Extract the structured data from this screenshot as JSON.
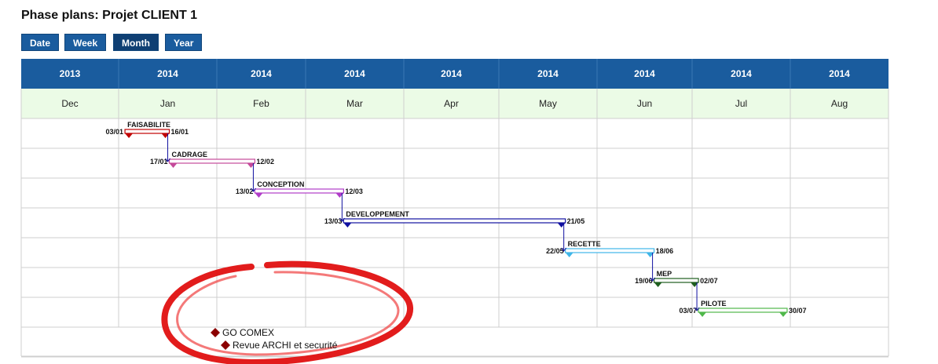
{
  "title": "Phase plans: Projet CLIENT 1",
  "view_buttons": [
    {
      "label": "Date",
      "active": false
    },
    {
      "label": "Week",
      "active": false
    },
    {
      "label": "Month",
      "active": true
    },
    {
      "label": "Year",
      "active": false
    }
  ],
  "timeline": {
    "years": [
      "2013",
      "2014",
      "2014",
      "2014",
      "2014",
      "2014",
      "2014",
      "2014",
      "2014"
    ],
    "months": [
      "Dec",
      "Jan",
      "Feb",
      "Mar",
      "Apr",
      "May",
      "Jun",
      "Jul",
      "Aug"
    ]
  },
  "tasks": [
    {
      "name": "FAISABILITE",
      "start": "03/01",
      "end": "16/01",
      "color": "#c00000"
    },
    {
      "name": "CADRAGE",
      "start": "17/01",
      "end": "12/02",
      "color": "#c54a9a"
    },
    {
      "name": "CONCEPTION",
      "start": "13/02",
      "end": "12/03",
      "color": "#b03cc8"
    },
    {
      "name": "DEVELOPPEMENT",
      "start": "13/03",
      "end": "21/05",
      "color": "#1010a0"
    },
    {
      "name": "RECETTE",
      "start": "22/05",
      "end": "18/06",
      "color": "#3fb6e8"
    },
    {
      "name": "MEP",
      "start": "19/06",
      "end": "02/07",
      "color": "#1e5e1e"
    },
    {
      "name": "PILOTE",
      "start": "03/07",
      "end": "30/07",
      "color": "#4fb84a"
    }
  ],
  "legend": [
    {
      "label": "GO COMEX",
      "color": "#8b0000"
    },
    {
      "label": "Revue ARCHI et securité",
      "color": "#8b0000"
    }
  ],
  "colors": {
    "header_bg": "#1a5c9e",
    "month_row_bg": "#ebfbe6",
    "annotation_circle": "#e01010"
  }
}
